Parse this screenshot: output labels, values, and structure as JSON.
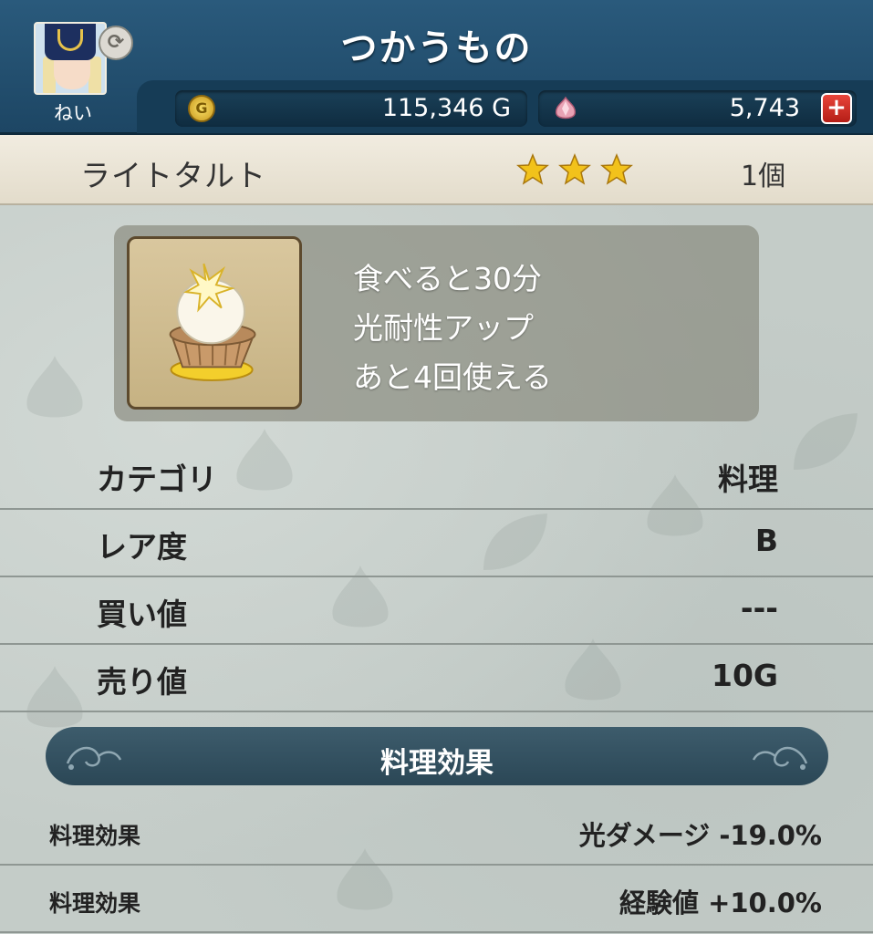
{
  "header": {
    "title": "つかうもの",
    "player_name": "ねい",
    "gold": "115,346 G",
    "gems": "5,743",
    "coin_glyph": "G",
    "plus_glyph": "+",
    "swap_glyph": "⟳"
  },
  "item": {
    "name": "ライトタルト",
    "star_count": 3,
    "count": "1個",
    "icon": "light-tart-icon",
    "description": [
      "食べると30分",
      "光耐性アップ",
      "あと4回使える"
    ]
  },
  "stats": [
    {
      "label": "カテゴリ",
      "value": "料理"
    },
    {
      "label": "レア度",
      "value": "B"
    },
    {
      "label": "買い値",
      "value": "---"
    },
    {
      "label": "売り値",
      "value": "10G"
    }
  ],
  "effects_header": "料理効果",
  "effects": [
    {
      "label": "料理効果",
      "value": "光ダメージ -19.0%"
    },
    {
      "label": "料理効果",
      "value": "経験値 +10.0%"
    }
  ],
  "colors": {
    "header_bg": "#1d4664",
    "item_bar_bg": "#ebe5d6",
    "star": "#f2c21b",
    "plus_button": "#d1322a"
  }
}
